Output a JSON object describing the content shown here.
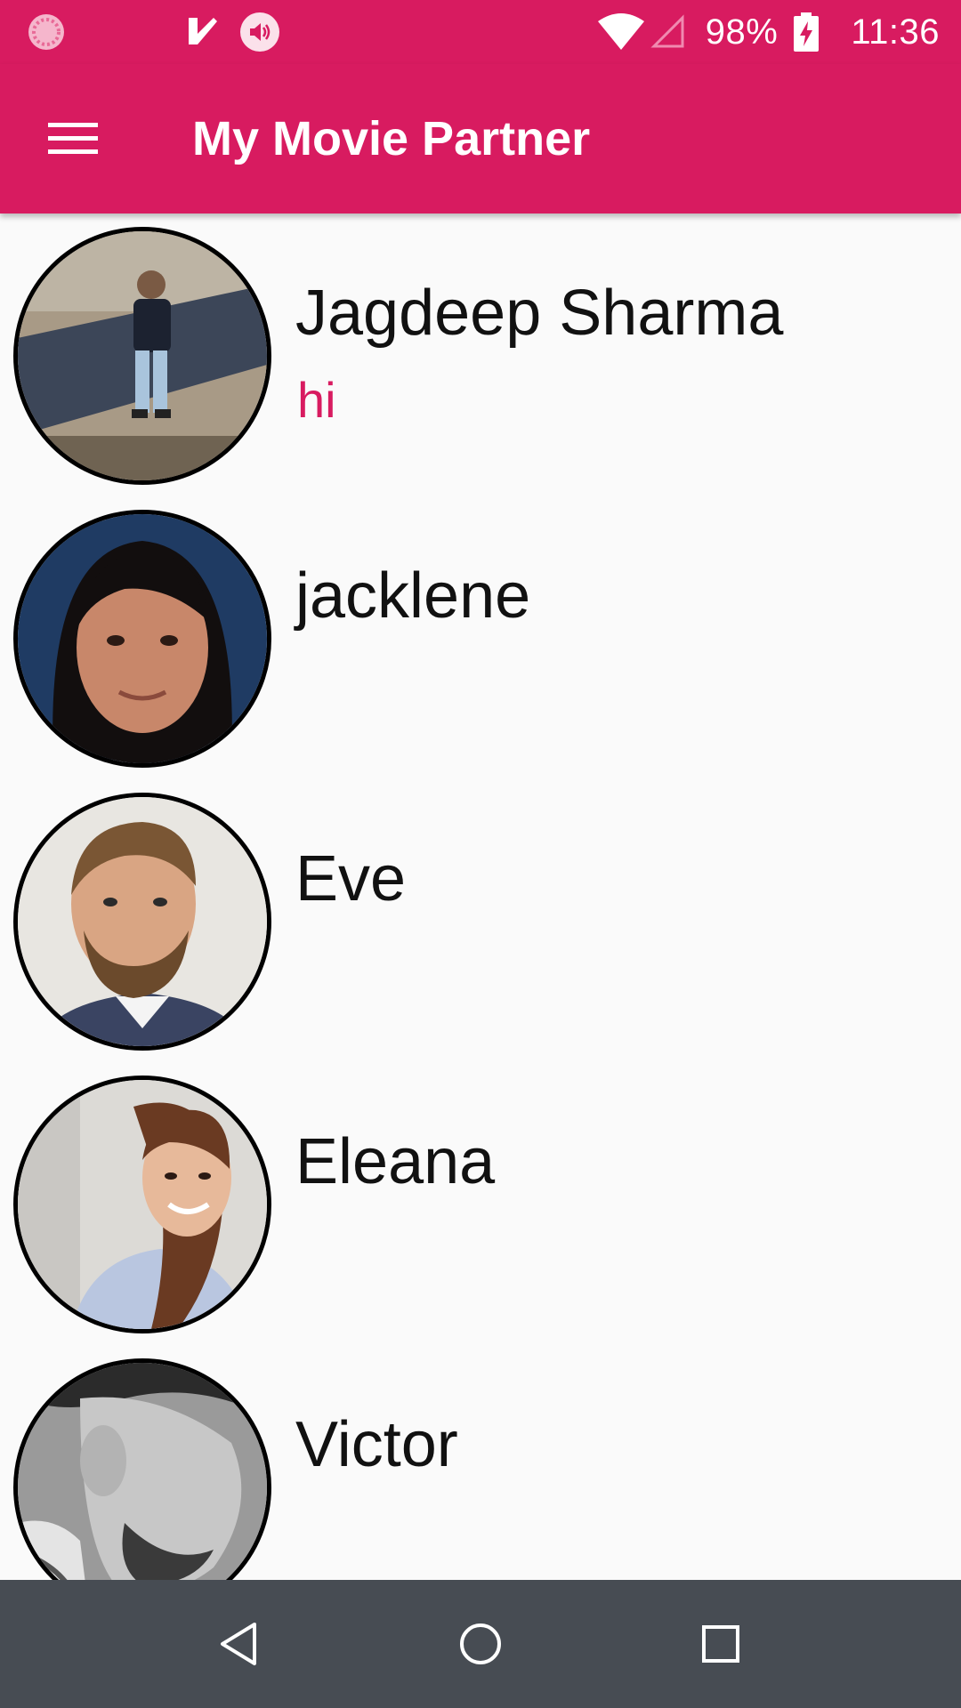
{
  "status_bar": {
    "battery": "98%",
    "time": "11:36",
    "icons": [
      "sync-icon",
      "task-check-icon",
      "volume-icon",
      "wifi-icon",
      "cell-signal-icon",
      "battery-charging-icon"
    ]
  },
  "app_bar": {
    "title": "My Movie Partner",
    "menu_icon": "hamburger-menu-icon"
  },
  "colors": {
    "primary": "#d81b60",
    "accent_text": "#d81b60",
    "list_background": "#fafafa",
    "nav_bar": "#474c53"
  },
  "contacts": [
    {
      "name": "Jagdeep Sharma",
      "message": "hi"
    },
    {
      "name": "jacklene",
      "message": ""
    },
    {
      "name": "Eve",
      "message": ""
    },
    {
      "name": "Eleana",
      "message": ""
    },
    {
      "name": "Victor",
      "message": ""
    }
  ],
  "nav_bar": {
    "icons": [
      "back-icon",
      "home-icon",
      "recents-icon"
    ]
  }
}
